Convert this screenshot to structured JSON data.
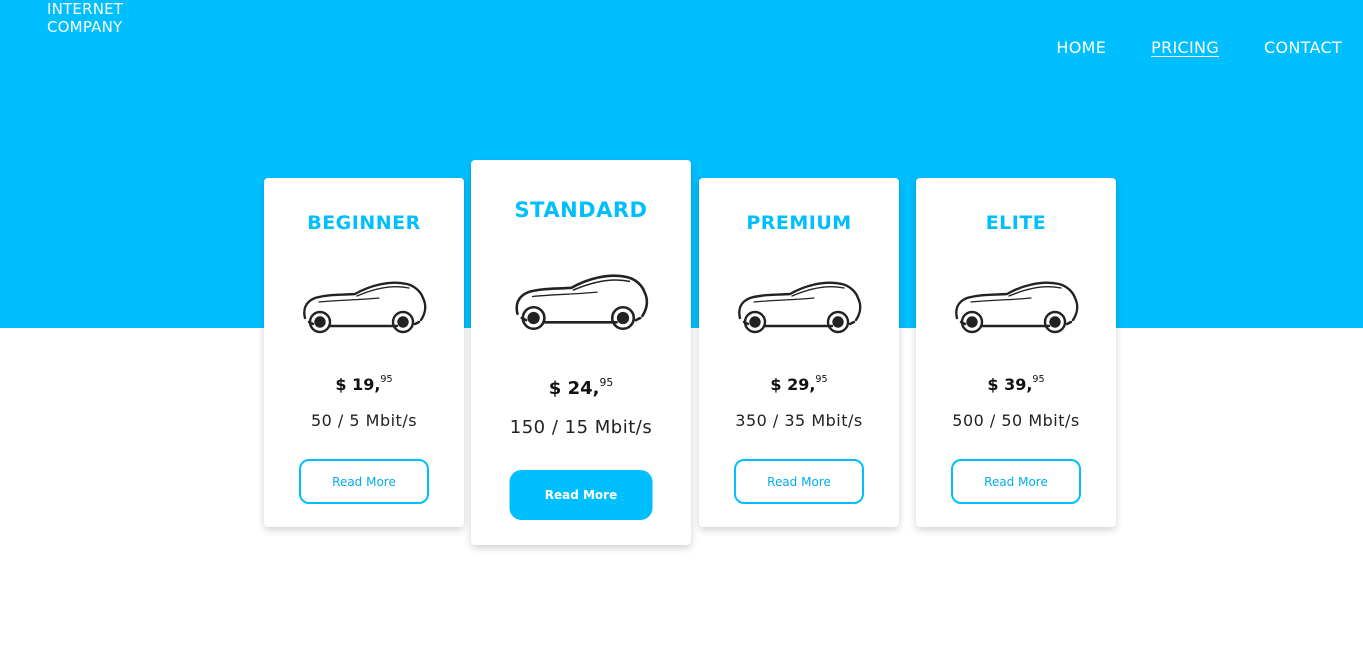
{
  "brand": {
    "line1": "INTERNET",
    "line2": "COMPANY"
  },
  "nav": [
    {
      "label": "HOME",
      "active": false
    },
    {
      "label": "PRICING",
      "active": true
    },
    {
      "label": "CONTACT",
      "active": false
    }
  ],
  "colors": {
    "accent": "#00bfff",
    "background": "#ffffff"
  },
  "plans": [
    {
      "name": "BEGINNER",
      "icon": "car-icon",
      "price_main": "$ 19,",
      "price_cents": "95",
      "speed": "50 / 5 Mbit/s",
      "button": "Read More"
    },
    {
      "name": "STANDARD",
      "icon": "car-icon",
      "price_main": "$ 24,",
      "price_cents": "95",
      "speed": "150 / 15 Mbit/s",
      "button": "Read More",
      "featured": true
    },
    {
      "name": "PREMIUM",
      "icon": "car-icon",
      "price_main": "$ 29,",
      "price_cents": "95",
      "speed": "350 / 35 Mbit/s",
      "button": "Read More"
    },
    {
      "name": "ELITE",
      "icon": "car-icon",
      "price_main": "$ 39,",
      "price_cents": "95",
      "speed": "500 / 50 Mbit/s",
      "button": "Read More"
    }
  ]
}
